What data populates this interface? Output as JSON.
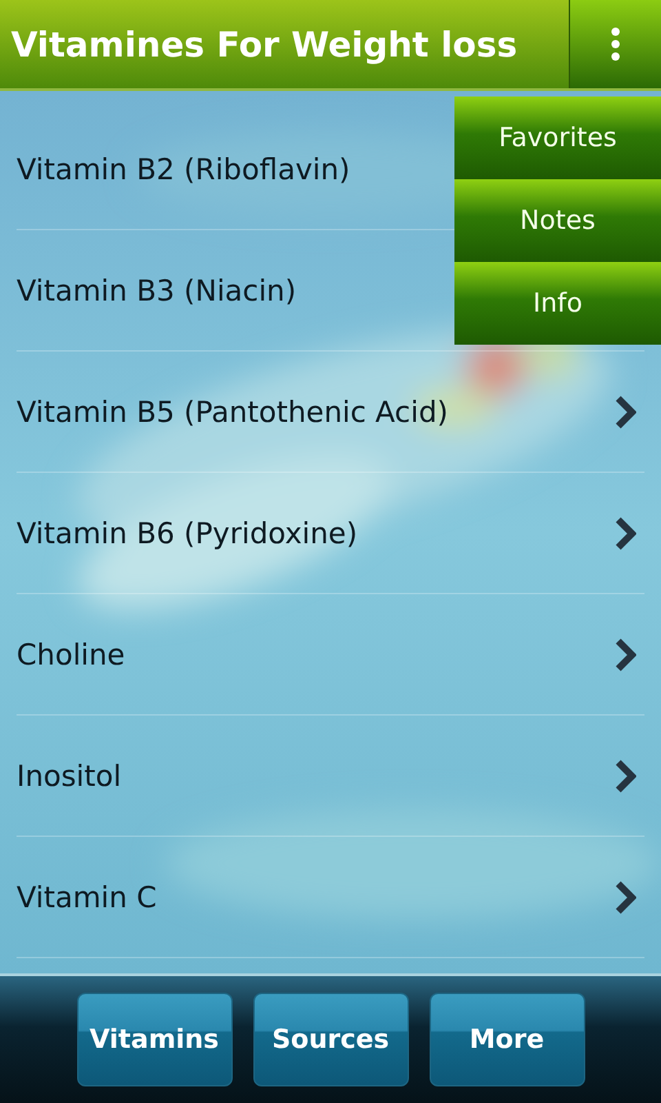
{
  "header": {
    "title": "Vitamines For Weight loss"
  },
  "overflow_menu": {
    "items": [
      "Favorites",
      "Notes",
      "Info"
    ]
  },
  "list": {
    "items": [
      {
        "label": "Vitamin B2 (Riboflavin)"
      },
      {
        "label": "Vitamin B3 (Niacin)"
      },
      {
        "label": "Vitamin B5 (Pantothenic Acid)",
        "arrow": true
      },
      {
        "label": "Vitamin B6 (Pyridoxine)",
        "arrow": true
      },
      {
        "label": "Choline",
        "arrow": true
      },
      {
        "label": "Inositol",
        "arrow": true
      },
      {
        "label": "Vitamin C",
        "arrow": true
      }
    ]
  },
  "bottom_bar": {
    "buttons": [
      "Vitamins",
      "Sources",
      "More"
    ]
  }
}
